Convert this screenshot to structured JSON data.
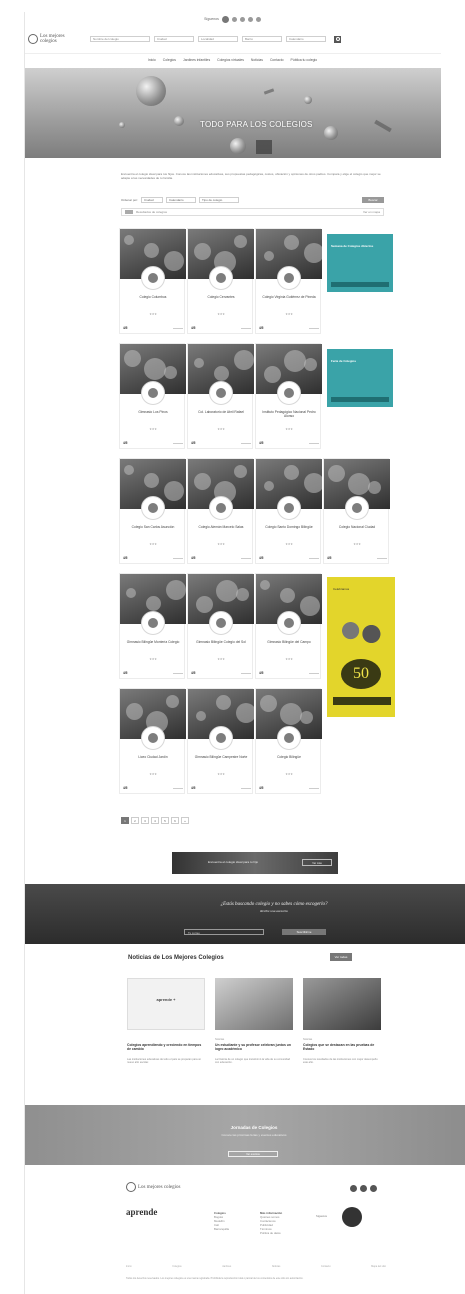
{
  "topbar": {
    "follow_label": "Síguenos"
  },
  "header": {
    "logo_text_1": "Los mejores",
    "logo_text_2": "colegios",
    "search_fields": [
      "Nombre del colegio",
      "Ciudad",
      "Localidad",
      "Barrio",
      "Calendario"
    ]
  },
  "nav": {
    "items": [
      "Inicio",
      "Colegios",
      "Jardines infantiles",
      "Colegios virtuales",
      "Noticias",
      "Contacto",
      "Pública tu colegio"
    ]
  },
  "hero": {
    "title": "TODO PARA LOS COLEGIOS"
  },
  "intro": {
    "text": "Encuentra el colegio ideal para tus hijos. Conoce las instituciones educativas, sus propuestas pedagógicas, costos, ubicación y opiniones de otros padres. Compara y elige el colegio que mejor se adapte a las necesidades de tu familia."
  },
  "filters": {
    "labels": [
      "Ordenar por:",
      "Ciudad",
      "Calendario",
      "Tipo de colegio"
    ],
    "button": "Buscar"
  },
  "sortbar": {
    "text": "Resultados de colegios",
    "right": "Ver en mapa"
  },
  "cards": [
    {
      "name": "Colegio Columbus",
      "rating": "★★★",
      "foot": "4/5"
    },
    {
      "name": "Colegio Cervantes",
      "rating": "★★★",
      "foot": "4/5"
    },
    {
      "name": "Colegio Virginia Gutiérrez de Pineda",
      "rating": "★★★",
      "foot": "4/5"
    },
    {
      "name": "Gimnasio Los Pinos",
      "rating": "★★★",
      "foot": "4/5"
    },
    {
      "name": "Col. Laboratorio de Abril Rafael",
      "rating": "★★★",
      "foot": "4/5"
    },
    {
      "name": "Instituto Pedagógico Nacional Pedro Alonso",
      "rating": "★★★",
      "foot": "4/5"
    },
    {
      "name": "Colegio San Carlos Asunción",
      "rating": "★★★",
      "foot": "4/5"
    },
    {
      "name": "Colegio Alemán Marcelo Salas",
      "rating": "★★★",
      "foot": "4/5"
    },
    {
      "name": "Colegio Santo Domingo Bilingüe",
      "rating": "★★★",
      "foot": "4/5"
    },
    {
      "name": "Colegio Nacional Ciudad",
      "rating": "★★★",
      "foot": "4/5"
    },
    {
      "name": "Gimnasio Bilingüe Montería Colegio",
      "rating": "★★★",
      "foot": "4/5"
    },
    {
      "name": "Gimnasio Bilingüe Colegio del Sol",
      "rating": "★★★",
      "foot": "4/5"
    },
    {
      "name": "Gimnasio Bilingüe del Campo",
      "rating": "★★★",
      "foot": "4/5"
    },
    {
      "name": "Liceo Ciudad Jardín",
      "rating": "★★★",
      "foot": "4/5"
    },
    {
      "name": "Gimnasio Bilingüe Campestre Norte",
      "rating": "★★★",
      "foot": "4/5"
    },
    {
      "name": "Colegio Bilingüe",
      "rating": "★★★",
      "foot": "4/5"
    }
  ],
  "ads": {
    "teal_1": "Semana de Colegios Abiertos",
    "teal_2": "Feria de Colegios",
    "yellow_text": "Celebramos",
    "yellow_big": "50"
  },
  "pager": [
    "1",
    "2",
    "3",
    "4",
    "5",
    "6",
    "»"
  ],
  "banner2": {
    "text": "Encuentra el colegio ideal para tu hijo",
    "button": "Ver más"
  },
  "band": {
    "quote": "¿Estás buscando colegio y no sabes cómo escogerlo?",
    "subquote": "Recibe una asesoría",
    "input_placeholder": "Tu correo",
    "button": "Suscribirme"
  },
  "news": {
    "title": "Noticias de Los Mejores Colegios",
    "button": "Ver todas",
    "items": [
      {
        "tag": "",
        "head": "Colegios aprendiendo y creciendo en tiempos de cambio",
        "body": "Las instituciones educativas de todo el país se preparan para un nuevo año escolar.",
        "logo": "aprende +"
      },
      {
        "tag": "Noticias",
        "head": "Un estudiante y su profesor celebran juntos un logro académico",
        "body": "La historia de un colegio que transformó la vida de su comunidad con educación.",
        "logo": ""
      },
      {
        "tag": "Noticias",
        "head": "Colegios que se destacan en las pruebas de Estado",
        "body": "Conoce los resultados de las instituciones con mejor desempeño este año.",
        "logo": ""
      }
    ]
  },
  "band2": {
    "title": "Jornadas de Colegios",
    "sub": "Conoce las próximas ferias y eventos educativos",
    "button": "Ver eventos"
  },
  "footer": {
    "logo_text": "Los mejores colegios",
    "brand": "aprende",
    "col1_head": "Colegios",
    "col1_items": [
      "Bogotá",
      "Medellín",
      "Cali",
      "Barranquilla"
    ],
    "col2_head": "Más información",
    "col2_items": [
      "Quiénes somos",
      "Contáctenos",
      "Publicidad",
      "Términos",
      "Política de datos"
    ],
    "sub_text": "Síguenos",
    "bottom_links": [
      "Inicio",
      "Colegios",
      "Jardines",
      "Noticias",
      "Contacto",
      "Mapa del sitio"
    ],
    "legal": "Todos los derechos reservados. Los mejores colegios es una marca registrada. Prohibida la reproducción total o parcial de los contenidos de este sitio sin autorización."
  }
}
